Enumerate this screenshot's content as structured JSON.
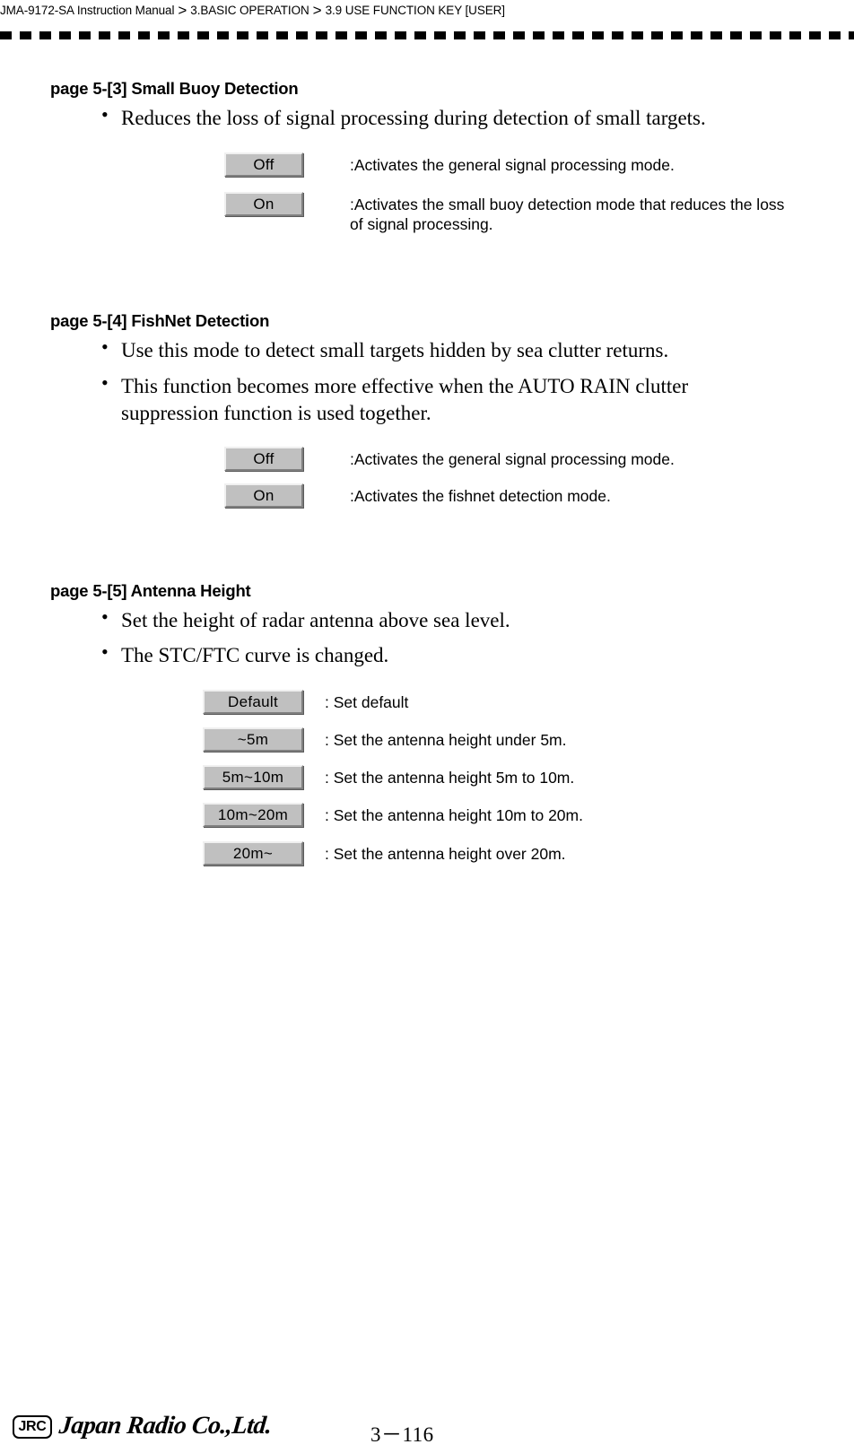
{
  "header": {
    "breadcrumb": [
      "JMA-9172-SA Instruction Manual",
      "3.BASIC OPERATION",
      "3.9  USE FUNCTION KEY [USER]"
    ],
    "separator": ">"
  },
  "colors": {
    "button_face": "#c0c0c0",
    "button_highlight": "#f0f0f0",
    "button_shadow": "#808080",
    "text": "#000000",
    "background": "#ffffff"
  },
  "sections": [
    {
      "title": "page 5-[3]  Small Buoy Detection",
      "bullets": [
        "Reduces the loss of signal processing during detection of small targets."
      ],
      "options": [
        {
          "button": "Off",
          "desc": ":Activates the general signal processing mode."
        },
        {
          "button": "On",
          "desc": ":Activates the small buoy detection mode that reduces the loss\nof signal processing."
        }
      ]
    },
    {
      "title": "page 5-[4]  FishNet Detection",
      "bullets": [
        "Use this mode to detect small targets hidden by sea clutter returns.",
        "This function becomes more effective when the AUTO RAIN clutter\nsuppression function is used together."
      ],
      "options": [
        {
          "button": "Off",
          "desc": ":Activates the general signal processing mode."
        },
        {
          "button": "On",
          "desc": ":Activates the fishnet detection mode."
        }
      ]
    },
    {
      "title": "page 5-[5]  Antenna Height",
      "bullets": [
        "Set the height of radar antenna above sea level.",
        "The STC/FTC curve is changed."
      ],
      "options": [
        {
          "button": "Default",
          "desc": ": Set default"
        },
        {
          "button": "~5m",
          "desc": ": Set the antenna height under 5m."
        },
        {
          "button": "5m~10m",
          "desc": ": Set the antenna height 5m to 10m."
        },
        {
          "button": "10m~20m",
          "desc": ": Set the antenna height 10m to 20m."
        },
        {
          "button": "20m~",
          "desc": ": Set the antenna height over 20m."
        }
      ]
    }
  ],
  "footer": {
    "logo_mark": "JRC",
    "company": "Japan Radio Co.,Ltd.",
    "page_number": "3－116"
  }
}
